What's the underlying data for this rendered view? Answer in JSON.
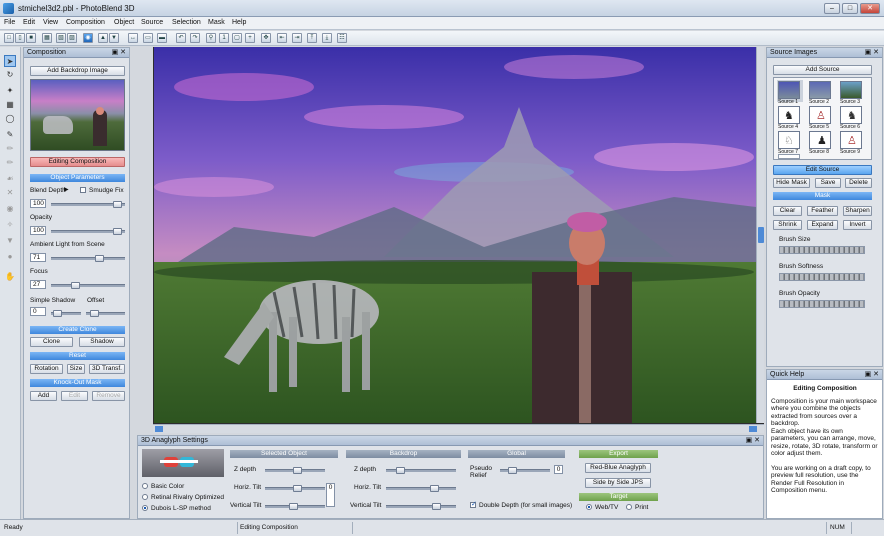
{
  "window": {
    "title": "stmichel3d2.pbl - PhotoBlend 3D"
  },
  "menu": [
    "File",
    "Edit",
    "View",
    "Composition",
    "Object",
    "Source",
    "Selection",
    "Mask",
    "Help"
  ],
  "composition_panel": {
    "title": "Composition",
    "add_backdrop": "Add Backdrop Image",
    "editing": "Editing Composition",
    "object_params": "Object Parameters",
    "blend_depth": "Blend Depth",
    "smudge_fix": "Smudge Fix",
    "blend_value": "100",
    "opacity": "Opacity",
    "opacity_value": "100",
    "ambient": "Ambient Light from Scene",
    "ambient_value": "71",
    "focus": "Focus",
    "focus_value": "27",
    "simple_shadow": "Simple Shadow",
    "offset": "Offset",
    "shadow_value": "0",
    "create_clone": "Create Clone",
    "clone": "Clone",
    "shadow": "Shadow",
    "reset": "Reset",
    "rotation": "Rotation",
    "size": "Size",
    "transf": "3D Transf.",
    "knockout": "Knock-Out Mask",
    "add": "Add",
    "edit": "Edit",
    "remove": "Remove"
  },
  "source_panel": {
    "title": "Source Images",
    "add_source": "Add Source",
    "sources": [
      "Source 1",
      "Source 2",
      "Source 3",
      "Source 4",
      "Source 5",
      "Source 6",
      "Source 7",
      "Source 8",
      "Source 9"
    ],
    "edit_source": "Edit Source",
    "hide_mask": "Hide Mask",
    "save": "Save",
    "delete": "Delete",
    "mask": "Mask",
    "clear": "Clear",
    "feather": "Feather",
    "sharpen": "Sharpen",
    "shrink": "Shrink",
    "expand": "Expand",
    "invert": "Invert",
    "brush_size": "Brush Size",
    "brush_softness": "Brush Softness",
    "brush_opacity": "Brush Opacity"
  },
  "help_panel": {
    "title": "Quick Help",
    "heading": "Editing Composition",
    "p1": "Composition is your main workspace where you combine the objects extracted from sources over a backdrop.",
    "p2": "Each object have its own parameters, you can arrange, move, resize, rotate, 3D rotate, transform or color adjust them.",
    "p3": "You are working on a draft copy, to preview full resolution, use the Render Full Resolution in Composition menu."
  },
  "anaglyph_panel": {
    "title": "3D Anaglyph Settings",
    "basic_color": "Basic Color",
    "retinal": "Retinal Rivalry Optimized",
    "dubois": "Dubois L-SP method",
    "selected_object": "Selected Object",
    "z_depth": "Z depth",
    "horiz_tilt": "Horiz. Tilt",
    "vert_tilt": "Vertical Tilt",
    "tilt_value": "0",
    "backdrop": "Backdrop",
    "global": "Global",
    "pseudo_relief": "Pseudo Relief",
    "relief_value": "0",
    "double_depth": "Double Depth (for small images)",
    "export": "Export",
    "red_blue": "Red-Blue Anaglyph",
    "side_by_side": "Side by Side JPS",
    "target": "Target",
    "web_tv": "Web/TV",
    "print": "Print"
  },
  "status": {
    "ready": "Ready",
    "mode": "Editing Composition",
    "num": "NUM"
  }
}
